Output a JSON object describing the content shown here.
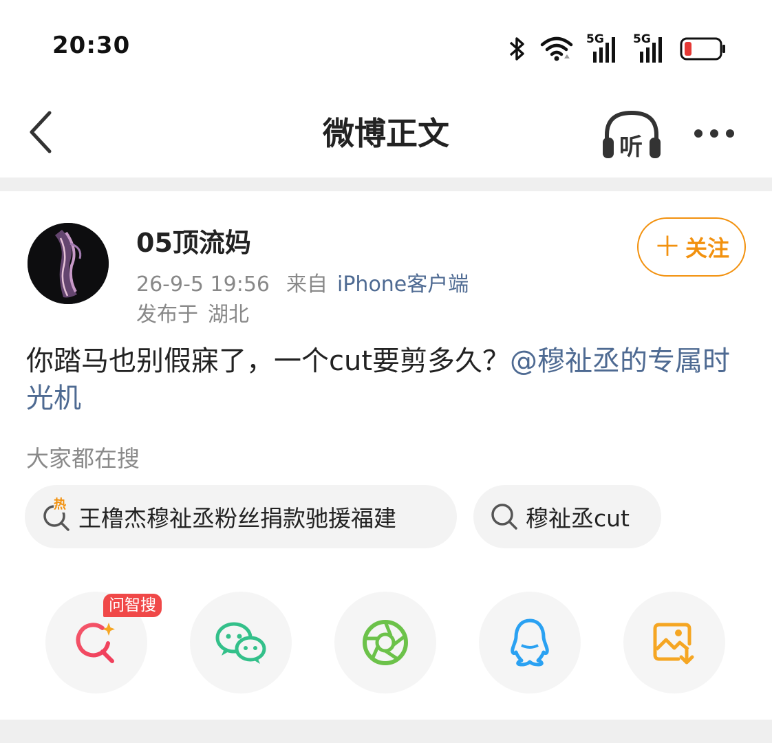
{
  "status_bar": {
    "time": "20:30",
    "icons": [
      "bluetooth-icon",
      "wifi-icon",
      "signal-5g-icon",
      "signal-5g-icon",
      "battery-low-icon"
    ],
    "network_labels": [
      "5G",
      "5G"
    ],
    "battery_color": "#e53935"
  },
  "nav": {
    "title": "微博正文",
    "listen_label": "听"
  },
  "post": {
    "username": "05顶流妈",
    "timestamp": "26-9-5 19:56",
    "source_label": "来自",
    "source": "iPhone客户端",
    "location_label": "发布于",
    "location": "湖北",
    "follow_label": "关注",
    "text": "你踏马也别假寐了，一个cut要剪多久？",
    "mention": "@穆祉丞的专属时光机"
  },
  "search": {
    "label": "大家都在搜",
    "hot_badge": "热",
    "chips": [
      "王橹杰穆祉丞粉丝捐款驰援福建",
      "穆祉丞cut"
    ]
  },
  "share": {
    "badge": "问智搜",
    "buttons": [
      "ai-search-icon",
      "wechat-icon",
      "moments-icon",
      "qq-icon",
      "save-image-icon"
    ]
  },
  "colors": {
    "accent_orange": "#f2910e",
    "link_blue": "#4e6a92",
    "meta_gray": "#888888",
    "badge_red": "#f04848"
  }
}
